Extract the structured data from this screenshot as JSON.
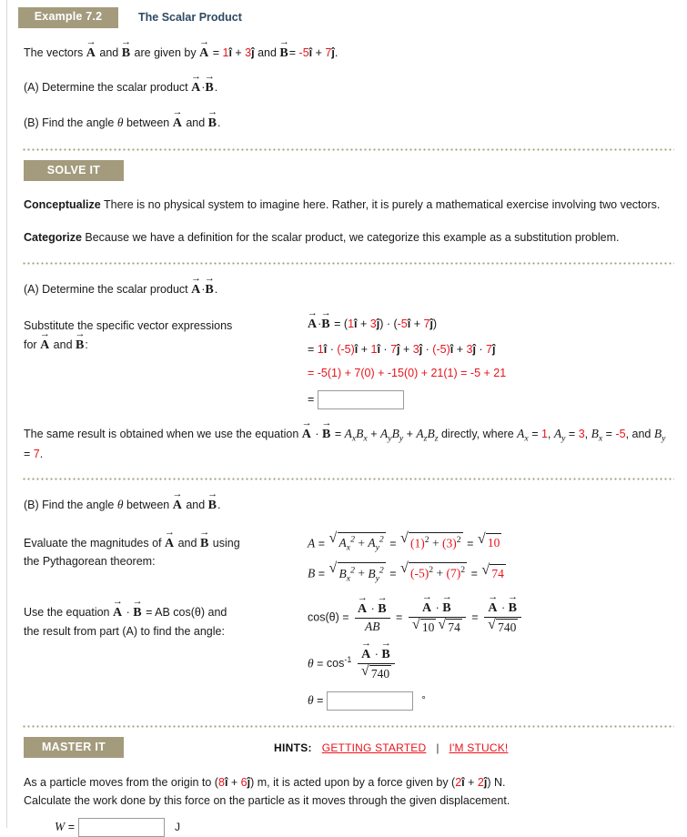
{
  "header": {
    "badge": "Example 7.2",
    "title": "The Scalar Product",
    "badge_bg": "#a39b7c",
    "title_color": "#2d4a63"
  },
  "intro": {
    "line1_prefix": "The vectors ",
    "line1_mid": " and ",
    "line1_given": " are given by ",
    "vec_a": "A",
    "vec_b": "B",
    "a_x": "1",
    "a_y": "3",
    "b_x": "-5",
    "b_y": "7",
    "i_hat": "i",
    "j_hat": "j",
    "part_a": "(A) Determine the scalar product",
    "part_b_pre": "(B) Find the angle",
    "part_b_theta": "θ",
    "part_b_post": "between"
  },
  "solve_it": {
    "label": "SOLVE IT",
    "conceptualize_lead": "Conceptualize",
    "conceptualize_text": "There is no physical system to imagine here. Rather, it is purely a mathematical exercise involving two vectors.",
    "categorize_lead": "Categorize",
    "categorize_text": "Because we have a definition for the scalar product, we categorize this example as a substitution problem."
  },
  "part_a": {
    "heading": "(A) Determine the scalar product",
    "instruction_line1": "Substitute the specific vector expressions",
    "instruction_line2": "for",
    "instruction_line2_end": ":",
    "eq1": "= (1î + 3ĵ) · (-5î + 7ĵ)",
    "eq2": "= 1î · (-5)î + 1î · 7ĵ + 3ĵ · (-5)î + 3ĵ · 7ĵ",
    "eq3": "= -5(1) + 7(0) + -15(0) + 21(1) = -5 + 21",
    "eq4_equals": "=",
    "answer_value": "",
    "answer_placeholder": "",
    "note_pre": "The same result is obtained when we use the equation",
    "note_mid": "directly, where",
    "note_ax": "1",
    "note_ay": "3",
    "note_bx": "-5",
    "note_by": "7",
    "note_and": "and"
  },
  "part_b": {
    "heading_pre": "(B) Find the angle",
    "theta": "θ",
    "heading_post": "between",
    "instruction_line1a": "Evaluate the magnitudes of",
    "instruction_line1b": "and",
    "instruction_line1c": "using",
    "instruction_line2": "the Pythagorean theorem:",
    "mag_a_result": "10",
    "mag_b_result": "74",
    "mag_a_x": "1",
    "mag_a_y": "3",
    "mag_b_x": "-5",
    "mag_b_y": "7",
    "instruction2_line1a": "Use the equation",
    "instruction2_line1b": "= AB cos(θ) and",
    "instruction2_line2": "the result from part (A) to find the angle:",
    "cos_label": "cos(θ)",
    "den_ab": "AB",
    "den_10": "10",
    "den_74": "74",
    "den_740": "740",
    "theta_eq": "θ =",
    "arccos": "cos",
    "arccos_exp": "-1",
    "answer_value": "",
    "degree_symbol": "°"
  },
  "master_it": {
    "label": "MASTER IT",
    "hints_label": "HINTS:",
    "getting_started": "GETTING STARTED",
    "separator": "|",
    "im_stuck": "I'M STUCK!",
    "link_color": "#e8121a",
    "problem_line1_a": "As a particle moves from the origin to (",
    "problem_disp_x": "8",
    "problem_disp_y": "6",
    "problem_line1_b": ") m, it is acted upon by a force given by (",
    "problem_force_x": "2",
    "problem_force_y": "2",
    "problem_line1_c": ") N.",
    "problem_line2": "Calculate the work done by this force on the particle as it moves through the given displacement.",
    "work_symbol": "W",
    "work_equals": "=",
    "work_value": "",
    "work_unit": "J"
  }
}
